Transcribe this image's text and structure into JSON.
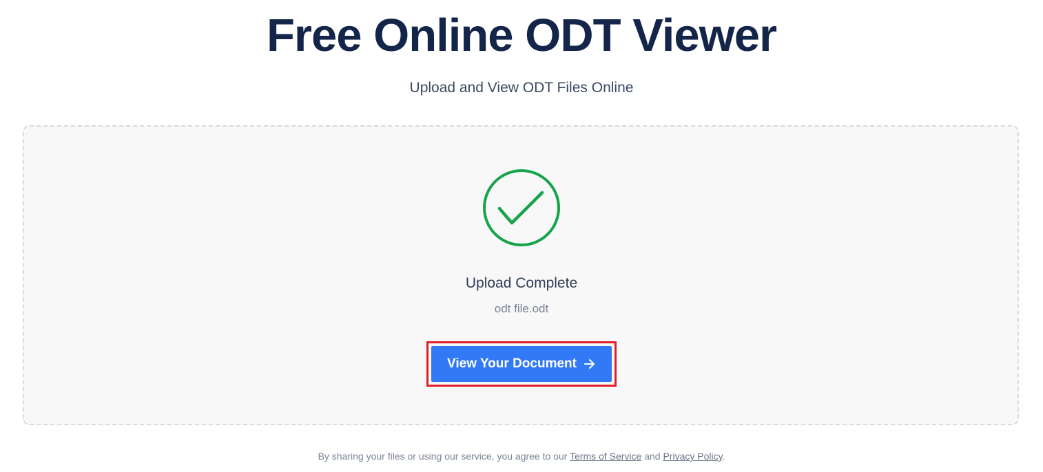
{
  "header": {
    "title": "Free Online ODT Viewer",
    "subtitle": "Upload and View ODT Files Online"
  },
  "upload": {
    "status_icon": "checkmark-circle-icon",
    "status_title": "Upload Complete",
    "file_name": "odt file.odt",
    "view_button_label": "View Your Document",
    "view_button_icon": "arrow-right-icon",
    "success_color": "#16a34a",
    "button_color": "#3279f6",
    "highlight_color": "#e11d2a"
  },
  "footer": {
    "prefix": "By sharing your files or using our service, you agree to our",
    "terms_link": "Terms of Service",
    "conjunction": "and",
    "privacy_link": "Privacy Policy",
    "suffix": "."
  }
}
